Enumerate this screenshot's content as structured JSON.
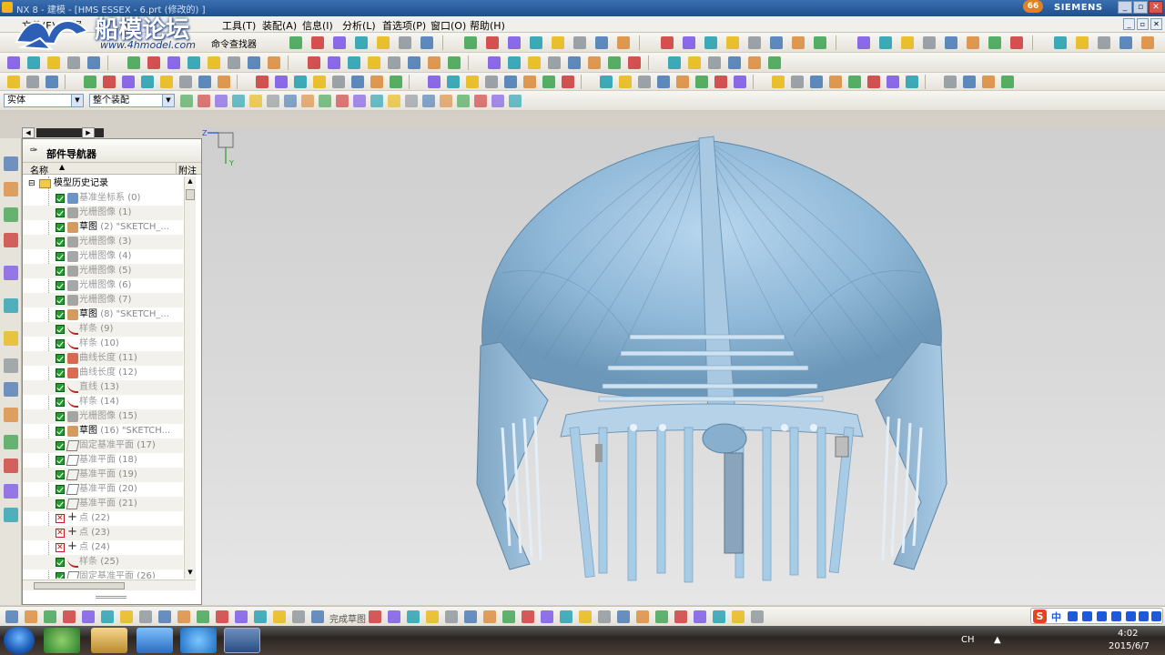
{
  "window": {
    "title": "NX 8 - 建模 - [HMS ESSEX - 6.prt  (修改的) ]",
    "brand": "SIEMENS",
    "notification_badge": "66",
    "controls": [
      "_",
      "▫",
      "✕"
    ]
  },
  "watermark": {
    "title": "船模论坛",
    "url": "www.4hmodel.com"
  },
  "menu": {
    "items": [
      "文件(F)",
      "编辑(E)",
      "视图(V)",
      "插入(S)",
      "格式(R)",
      "工具(T)",
      "装配(A)",
      "信息(I)",
      "分析(L)",
      "首选项(P)",
      "窗口(O)",
      "帮助(H)"
    ],
    "visible_items": [
      {
        "label": "文件(F)",
        "id": "file"
      },
      {
        "label": "编辑",
        "id": "edit"
      },
      {
        "label": "工具(T)",
        "id": "tools"
      },
      {
        "label": "装配(A)",
        "id": "assembly"
      },
      {
        "label": "信息(I)",
        "id": "info"
      },
      {
        "label": "分析(L)",
        "id": "analysis"
      },
      {
        "label": "首选项(P)",
        "id": "preferences"
      },
      {
        "label": "窗口(O)",
        "id": "window"
      },
      {
        "label": "帮助(H)",
        "id": "help"
      }
    ],
    "command_finder": "命令查找器"
  },
  "selection_bar": {
    "filter_value": "实体",
    "scope_value": "整个装配"
  },
  "navigator": {
    "title": "部件导航器",
    "col_name": "名称",
    "col_sort": "▲",
    "col_note": "附注",
    "root": "模型历史记录",
    "items": [
      {
        "label": "基准坐标系",
        "num": "(0)",
        "state": "on",
        "icon": "csys-icon",
        "dim": true
      },
      {
        "label": "光栅图像",
        "num": "(1)",
        "state": "on",
        "icon": "raster-image-icon",
        "dim": true
      },
      {
        "label": "草图",
        "num": "(2) \"SKETCH_...",
        "state": "on",
        "icon": "sketch-icon",
        "dim": false
      },
      {
        "label": "光栅图像",
        "num": "(3)",
        "state": "on",
        "icon": "raster-image-icon",
        "dim": true
      },
      {
        "label": "光栅图像",
        "num": "(4)",
        "state": "on",
        "icon": "raster-image-icon",
        "dim": true
      },
      {
        "label": "光栅图像",
        "num": "(5)",
        "state": "on",
        "icon": "raster-image-icon",
        "dim": true
      },
      {
        "label": "光栅图像",
        "num": "(6)",
        "state": "on",
        "icon": "raster-image-icon",
        "dim": true
      },
      {
        "label": "光栅图像",
        "num": "(7)",
        "state": "on",
        "icon": "raster-image-icon",
        "dim": true
      },
      {
        "label": "草图",
        "num": "(8) \"SKETCH_...",
        "state": "on",
        "icon": "sketch-icon",
        "dim": false
      },
      {
        "label": "样条",
        "num": "(9)",
        "state": "on",
        "icon": "spline-icon",
        "dim": true
      },
      {
        "label": "样条",
        "num": "(10)",
        "state": "on",
        "icon": "spline-icon",
        "dim": true
      },
      {
        "label": "曲线长度",
        "num": "(11)",
        "state": "on",
        "icon": "curve-length-icon",
        "dim": true
      },
      {
        "label": "曲线长度",
        "num": "(12)",
        "state": "on",
        "icon": "curve-length-icon",
        "dim": true
      },
      {
        "label": "直线",
        "num": "(13)",
        "state": "on",
        "icon": "line-icon",
        "dim": true
      },
      {
        "label": "样条",
        "num": "(14)",
        "state": "on",
        "icon": "spline-icon",
        "dim": true
      },
      {
        "label": "光栅图像",
        "num": "(15)",
        "state": "on",
        "icon": "raster-image-icon",
        "dim": true
      },
      {
        "label": "草图",
        "num": "(16) \"SKETCH...",
        "state": "on",
        "icon": "sketch-icon",
        "dim": false
      },
      {
        "label": "固定基准平面",
        "num": "(17)",
        "state": "on",
        "icon": "datum-plane-icon",
        "dim": true
      },
      {
        "label": "基准平面",
        "num": "(18)",
        "state": "on",
        "icon": "datum-plane-icon",
        "dim": true
      },
      {
        "label": "基准平面",
        "num": "(19)",
        "state": "on",
        "icon": "datum-plane-icon",
        "dim": true
      },
      {
        "label": "基准平面",
        "num": "(20)",
        "state": "on",
        "icon": "datum-plane-icon",
        "dim": true
      },
      {
        "label": "基准平面",
        "num": "(21)",
        "state": "on",
        "icon": "datum-plane-icon",
        "dim": true
      },
      {
        "label": "点",
        "num": "(22)",
        "state": "off",
        "icon": "point-icon",
        "dim": true
      },
      {
        "label": "点",
        "num": "(23)",
        "state": "off",
        "icon": "point-icon",
        "dim": true
      },
      {
        "label": "点",
        "num": "(24)",
        "state": "off",
        "icon": "point-icon",
        "dim": true
      },
      {
        "label": "样条",
        "num": "(25)",
        "state": "on",
        "icon": "spline-icon",
        "dim": true
      },
      {
        "label": "固定基准平面",
        "num": "(26)",
        "state": "on",
        "icon": "datum-plane-icon",
        "dim": true
      }
    ]
  },
  "bottom_toolbar": {
    "finish_sketch": "完成草图"
  },
  "axis_triad": {
    "z": "Z",
    "y": "Y"
  },
  "ime": {
    "logo": "S",
    "mode": "中"
  },
  "taskbar": {
    "lang": "CH",
    "time": "4:02",
    "date": "2015/6/7"
  },
  "colors": {
    "model": "#9cc6e6",
    "model_shade": "#6f98b8",
    "viewport_bg": "#d6d6d6",
    "checkbox_green": "#1f9e2e",
    "suppressed_red": "#c81a1a"
  }
}
